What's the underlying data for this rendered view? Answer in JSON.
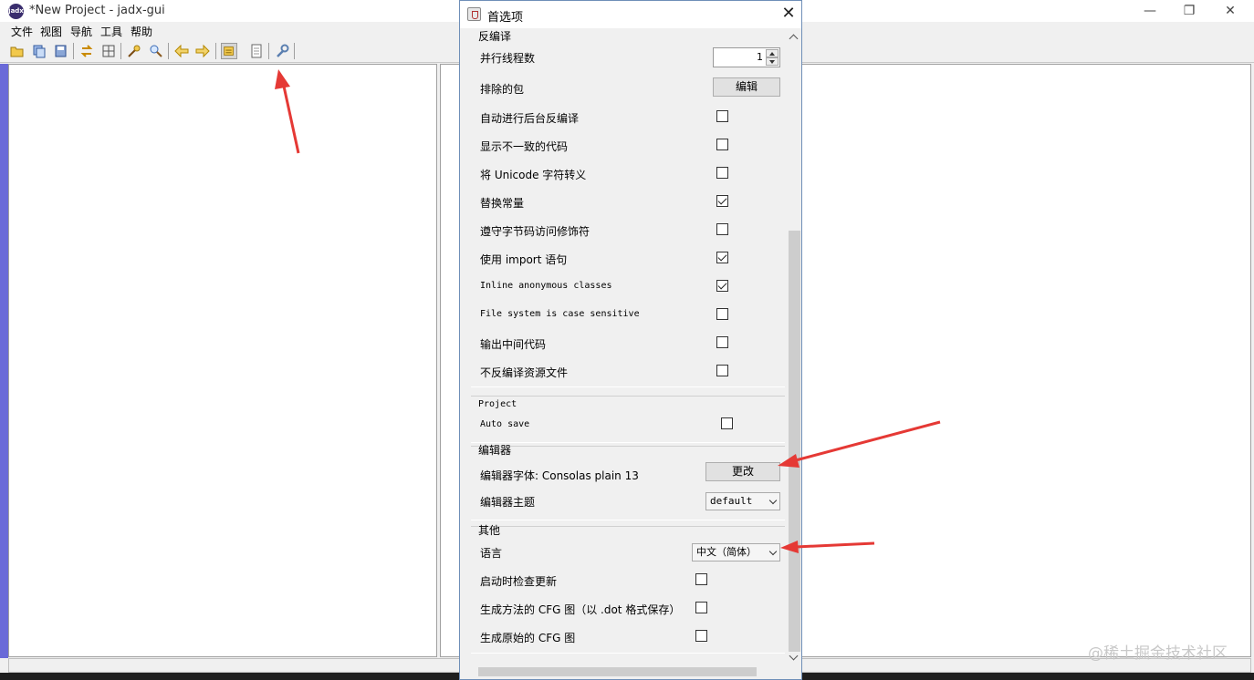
{
  "window": {
    "title": "*New Project - jadx-gui",
    "app_icon_text": "jadx"
  },
  "menubar": {
    "items": [
      "文件",
      "视图",
      "导航",
      "工具",
      "帮助"
    ]
  },
  "toolbar": {
    "icons": [
      "open-file-icon",
      "add-files-icon",
      "save-all-icon",
      "sync-icon",
      "flatten-packages-icon",
      "search-text-icon",
      "search-class-icon",
      "back-arrow-icon",
      "forward-arrow-icon",
      "decompile-all-icon",
      "log-viewer-icon",
      "preferences-wrench-icon"
    ]
  },
  "dialog": {
    "title": "首选项",
    "close_glyph": "✕",
    "sections": {
      "decompile": {
        "title": "反编译",
        "threads_label": "并行线程数",
        "threads_value": "1",
        "excluded_label": "排除的包",
        "excluded_button": "编辑",
        "auto_bg_label": "自动进行后台反编译",
        "show_inconsistent_label": "显示不一致的代码",
        "escape_unicode_label": "将 Unicode 字符转义",
        "replace_consts_label": "替换常量",
        "respect_bytecode_label": "遵守字节码访问修饰符",
        "use_imports_label": "使用 import 语句",
        "inline_anon_label": "Inline anonymous classes",
        "fs_case_label": "File system is case sensitive",
        "output_raw_label": "输出中间代码",
        "skip_resources_label": "不反编译资源文件",
        "checks": {
          "auto_bg": false,
          "show_inconsistent": false,
          "escape_unicode": false,
          "replace_consts": true,
          "respect_bytecode": false,
          "use_imports": true,
          "inline_anon": true,
          "fs_case": false,
          "output_raw": false,
          "skip_resources": false
        }
      },
      "project": {
        "title": "Project",
        "autosave_label": "Auto save",
        "autosave_checked": false
      },
      "editor": {
        "title": "编辑器",
        "font_label": "编辑器字体: Consolas plain 13",
        "font_button": "更改",
        "theme_label": "编辑器主题",
        "theme_value": "default"
      },
      "other": {
        "title": "其他",
        "language_label": "语言",
        "language_value": "中文（简体）",
        "check_updates_label": "启动时检查更新",
        "cfg_dot_label": "生成方法的 CFG 图（以 .dot 格式保存）",
        "raw_cfg_label": "生成原始的 CFG 图",
        "checks": {
          "check_updates": false,
          "cfg_dot": false,
          "raw_cfg": false
        }
      }
    }
  },
  "watermark": "@稀土掘金技术社区",
  "colors": {
    "annotation_arrow": "#e53935",
    "left_strip": "#6a6ad8",
    "dialog_border": "#6f8fb8"
  }
}
